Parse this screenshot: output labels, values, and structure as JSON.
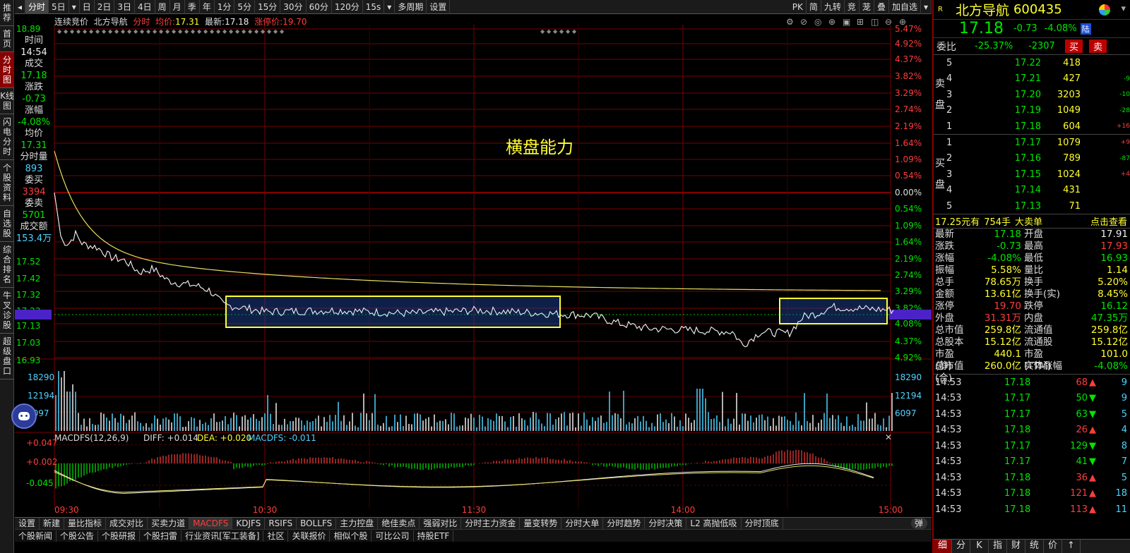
{
  "leftnav": [
    "推荐",
    "首页",
    "分时图",
    "K线图",
    "闪电分时",
    "个股资料",
    "自选股",
    "综合排名",
    "牛叉诊股",
    "超级盘口"
  ],
  "topbar": {
    "left": [
      "◂",
      "分时",
      "5日",
      "▾",
      "日",
      "2日",
      "3日",
      "4日",
      "周",
      "月",
      "季",
      "年",
      "1分",
      "5分",
      "15分",
      "30分",
      "60分",
      "120分",
      "15s",
      "▾",
      "多周期",
      "设置"
    ],
    "right": [
      "PK",
      "简",
      "九转",
      "竞",
      "茏",
      "叠",
      "加自选",
      "▾"
    ]
  },
  "info": {
    "phase": "连续竞价",
    "name": "北方导航",
    "mode": "分时",
    "avg_label": "均价:",
    "avg": "17.31",
    "last_label": "最新:",
    "last": "17.18",
    "limit_label": "涨停价:",
    "limit": "19.70"
  },
  "lpanel": [
    {
      "k": "时间",
      "v": "14:54",
      "c": "white"
    },
    {
      "k": "成交",
      "v": "17.18",
      "c": "green"
    },
    {
      "k": "涨跌",
      "v": "-0.73",
      "c": "green"
    },
    {
      "k": "涨幅",
      "v": "-4.08%",
      "c": "green"
    },
    {
      "k": "均价",
      "v": "17.31",
      "c": "green"
    },
    {
      "k": "分时量",
      "v": "893",
      "c": "cyan"
    },
    {
      "k": "委买",
      "v": "3394",
      "c": "red"
    },
    {
      "k": "委卖",
      "v": "5701",
      "c": "green"
    },
    {
      "k": "成交额",
      "v": "153.4万",
      "c": "cyan"
    }
  ],
  "yleft": [
    "18.89",
    "17.52",
    "17.42",
    "17.32",
    "17.23",
    "17.18",
    "17.13",
    "17.03",
    "16.93"
  ],
  "yright": [
    "5.47%",
    "4.92%",
    "4.37%",
    "3.82%",
    "3.29%",
    "2.74%",
    "2.19%",
    "1.64%",
    "1.09%",
    "0.54%",
    "0.00%",
    "0.54%",
    "1.09%",
    "1.64%",
    "2.19%",
    "2.74%",
    "3.29%",
    "3.82%",
    "4.08%",
    "4.37%",
    "4.92%",
    "5.47%"
  ],
  "vol_labels": [
    "18290",
    "12194",
    "6097"
  ],
  "annotation": "横盘能力",
  "macd": {
    "title": "MACDFS(12,26,9)",
    "diff": "DIFF: +0.014",
    "dea": "DEA: +0.020",
    "macdfs": "MACDFS: -0.011",
    "y": [
      "+0.047",
      "+0.002",
      "-0.045"
    ]
  },
  "times": [
    "09:30",
    "10:30",
    "11:30",
    "14:00",
    "15:00"
  ],
  "bottomtabs": [
    "设置",
    "新建",
    "量比指标",
    "成交对比",
    "买卖力道",
    "MACDFS",
    "KDJFS",
    "RSIFS",
    "BOLLFS",
    "主力控盘",
    "绝佳卖点",
    "强弱对比",
    "分时主力资金",
    "量变转势",
    "分时大单",
    "分时趋势",
    "分时决策",
    "L2 高抛低吸",
    "分时顶底"
  ],
  "bottomtabs2": [
    "个股新闻",
    "个股公告",
    "个股研报",
    "个股扫雷",
    "行业资讯[军工装备]",
    "社区",
    "关联报价",
    "相似个股",
    "可比公司",
    "持股ETF"
  ],
  "toggle": "弹",
  "right": {
    "name": "北方导航",
    "code": "600435",
    "price": "17.18",
    "chg": "-0.73",
    "pct": "-4.08%",
    "market": "陆",
    "weibi_label": "委比",
    "weibi": "-25.37%",
    "weicha": "-2307",
    "buy_btn": "买",
    "sell_btn": "卖",
    "sell_label": "卖盘",
    "buy_label": "买盘",
    "asks": [
      {
        "l": "5",
        "p": "17.22",
        "v": "418",
        "c": ""
      },
      {
        "l": "4",
        "p": "17.21",
        "v": "427",
        "c": "-9"
      },
      {
        "l": "3",
        "p": "17.20",
        "v": "3203",
        "c": "-10"
      },
      {
        "l": "2",
        "p": "17.19",
        "v": "1049",
        "c": "-28"
      },
      {
        "l": "1",
        "p": "17.18",
        "v": "604",
        "c": "+16"
      }
    ],
    "bids": [
      {
        "l": "1",
        "p": "17.17",
        "v": "1079",
        "c": "+9"
      },
      {
        "l": "2",
        "p": "17.16",
        "v": "789",
        "c": "-87"
      },
      {
        "l": "3",
        "p": "17.15",
        "v": "1024",
        "c": "+4"
      },
      {
        "l": "4",
        "p": "17.14",
        "v": "431",
        "c": ""
      },
      {
        "l": "5",
        "p": "17.13",
        "v": "71",
        "c": ""
      }
    ],
    "bigorder": {
      "a": "17.25元有",
      "b": "754手",
      "c": "大卖单",
      "d": "点击查看"
    },
    "stats": [
      [
        "最新",
        "17.18",
        "开盘",
        "17.91"
      ],
      [
        "涨跌",
        "-0.73",
        "最高",
        "17.93"
      ],
      [
        "涨幅",
        "-4.08%",
        "最低",
        "16.93"
      ],
      [
        "振幅",
        "5.58%",
        "量比",
        "1.14"
      ],
      [
        "总手",
        "78.65万",
        "换手",
        "5.20%"
      ],
      [
        "金额",
        "13.61亿",
        "换手(实)",
        "8.45%"
      ],
      [
        "涨停",
        "19.70",
        "跌停",
        "16.12"
      ],
      [
        "外盘",
        "31.31万",
        "内盘",
        "47.35万"
      ],
      [
        "总市值",
        "259.8亿",
        "流通值",
        "259.8亿"
      ],
      [
        "总股本",
        "15.12亿",
        "流通股",
        "15.12亿"
      ],
      [
        "市盈(静)",
        "440.1",
        "市盈(TTM)",
        "101.0"
      ],
      [
        "总市值(合)",
        "260.0亿",
        "实体涨幅",
        "-4.08%"
      ]
    ],
    "ticks": [
      [
        "14:53",
        "17.18",
        "68",
        "up",
        "9"
      ],
      [
        "14:53",
        "17.17",
        "50",
        "down",
        "9"
      ],
      [
        "14:53",
        "17.17",
        "63",
        "down",
        "5"
      ],
      [
        "14:53",
        "17.18",
        "26",
        "up",
        "4"
      ],
      [
        "14:53",
        "17.17",
        "129",
        "down",
        "8"
      ],
      [
        "14:53",
        "17.17",
        "41",
        "down",
        "7"
      ],
      [
        "14:53",
        "17.18",
        "36",
        "up",
        "5"
      ],
      [
        "14:53",
        "17.18",
        "121",
        "up",
        "18"
      ],
      [
        "14:53",
        "17.18",
        "113",
        "up",
        "11"
      ]
    ],
    "bottom": [
      "细",
      "分",
      "K",
      "指",
      "财",
      "统",
      "价",
      "↑"
    ]
  }
}
